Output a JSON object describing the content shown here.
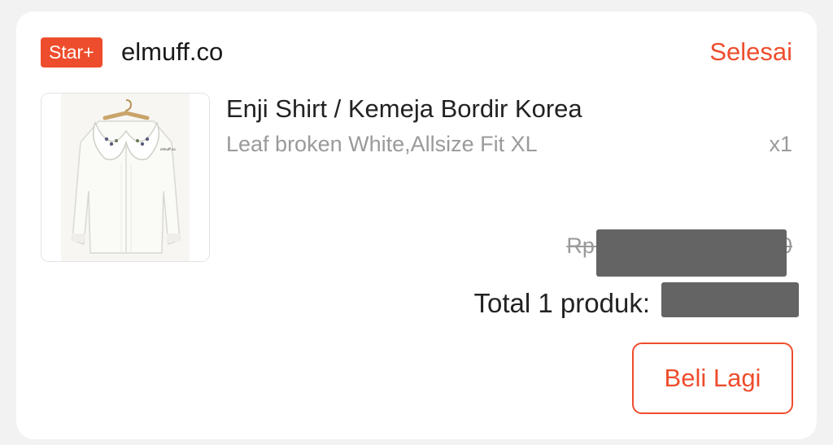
{
  "shop": {
    "badge": "Star+",
    "name": "elmuff.co",
    "status": "Selesai"
  },
  "product": {
    "title": "Enji Shirt / Kemeja Bordir Korea",
    "variant": "Leaf broken White,Allsize Fit XL",
    "quantity": "x1",
    "original_price": "Rp11",
    "price_suffix": "0",
    "image_caption": "elmuff.co"
  },
  "order": {
    "total_label": "Total 1 produk:"
  },
  "actions": {
    "buy_again": "Beli Lagi"
  },
  "colors": {
    "accent": "#ee4d2d",
    "muted_text": "#9a9a9a",
    "redaction": "#646464"
  }
}
